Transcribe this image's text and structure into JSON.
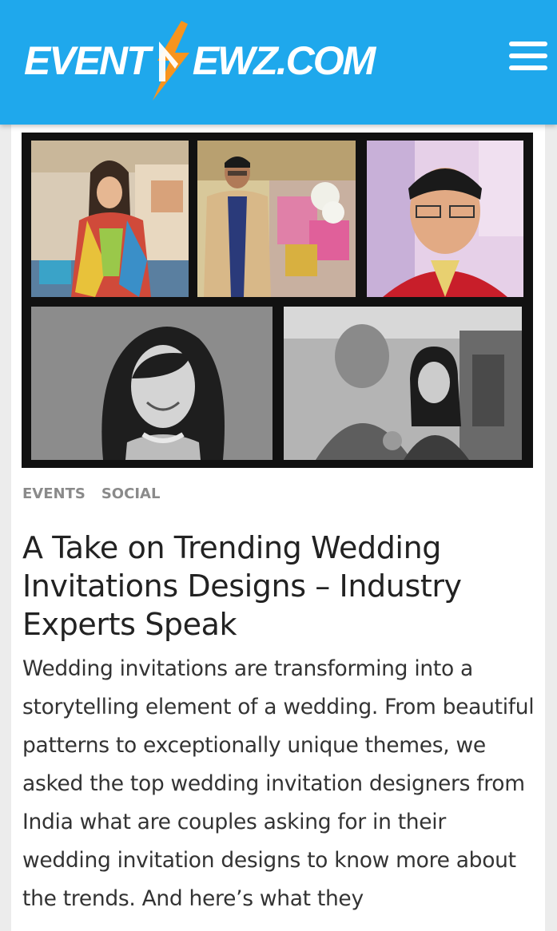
{
  "header": {
    "logo_text_left": "EVENT",
    "logo_text_right": "EWZ.COM",
    "logo_bolt_icon": "lightning-bolt-icon",
    "menu_icon": "hamburger-menu-icon",
    "background_color": "#1fa8ec"
  },
  "article": {
    "tags": [
      "EVENTS",
      "SOCIAL"
    ],
    "title": "A Take on Trending Wedding Invitations Designs – Industry Experts Speak",
    "excerpt": "Wedding invitations are transforming into a storytelling element of a wedding. From beautiful patterns to exceptionally unique themes, we asked the top wedding invitation designers from India what are couples asking for in their wedding invitation designs to know more about the trends. And here’s what they"
  },
  "colors": {
    "accent_blue": "#1fa8ec",
    "bolt_orange": "#f7941d",
    "tag_gray": "#8a8a8a",
    "title_text": "#222222"
  }
}
